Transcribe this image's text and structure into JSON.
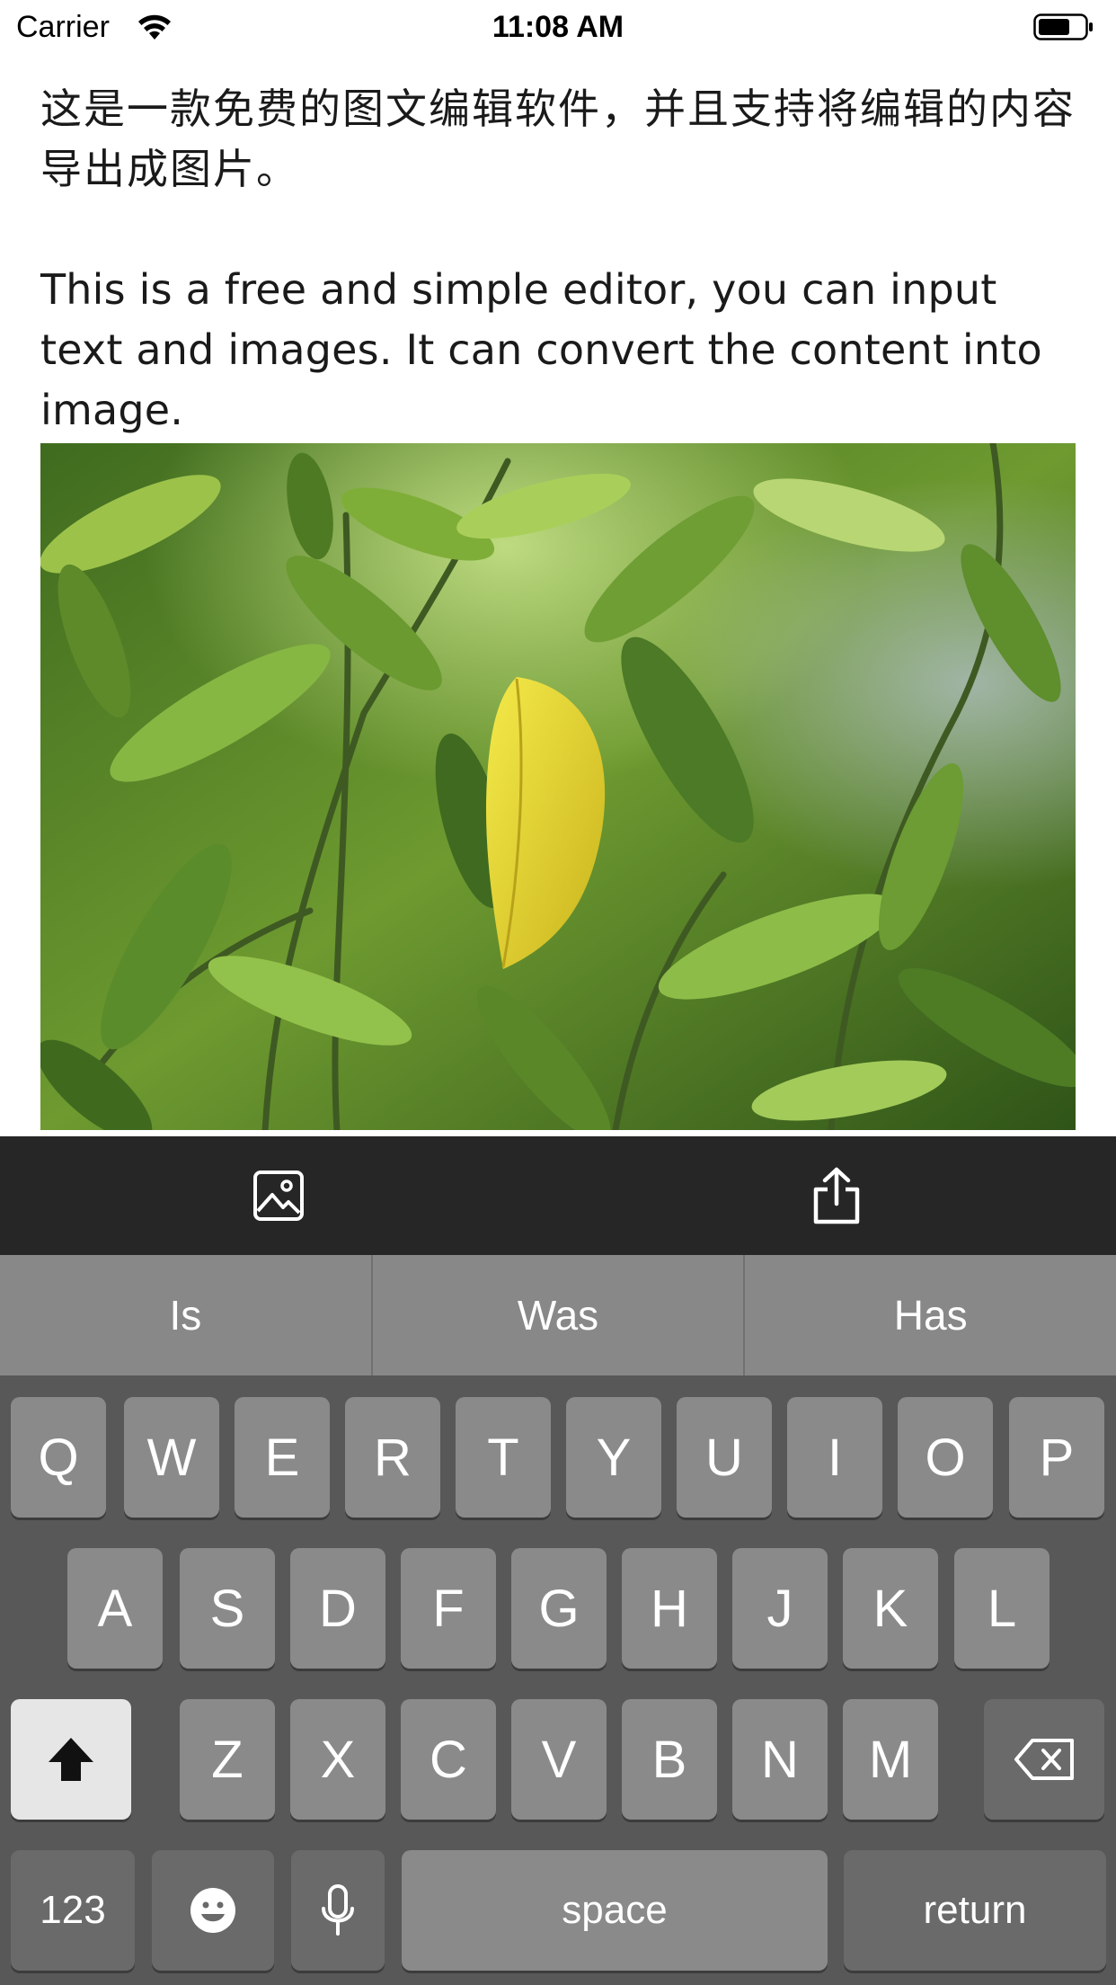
{
  "status_bar": {
    "carrier": "Carrier",
    "time": "11:08 AM",
    "icons": [
      "wifi-icon",
      "battery-icon"
    ]
  },
  "document": {
    "paragraph_cn": "这是一款免费的图文编辑软件，并且支持将编辑的内容导出成图片。",
    "paragraph_en": "This is a free and simple editor, you can input text and images. It can convert the content into image.",
    "image": "green-leaves-photo"
  },
  "toolbar": {
    "insert_image_icon": "image-icon",
    "share_icon": "share-icon"
  },
  "keyboard": {
    "suggestions": [
      "Is",
      "Was",
      "Has"
    ],
    "row1": [
      "Q",
      "W",
      "E",
      "R",
      "T",
      "Y",
      "U",
      "I",
      "O",
      "P"
    ],
    "row2": [
      "A",
      "S",
      "D",
      "F",
      "G",
      "H",
      "J",
      "K",
      "L"
    ],
    "row3": [
      "Z",
      "X",
      "C",
      "V",
      "B",
      "N",
      "M"
    ],
    "numbers_label": "123",
    "space_label": "space",
    "return_label": "return",
    "icons": [
      "shift-icon",
      "backspace-icon",
      "emoji-icon",
      "microphone-icon"
    ]
  }
}
